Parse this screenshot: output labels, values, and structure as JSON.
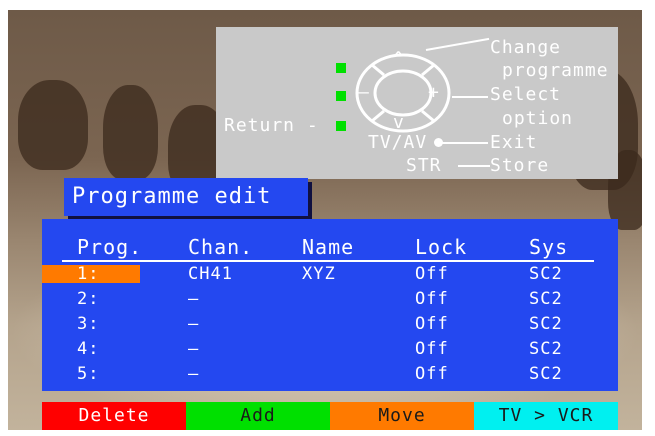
{
  "help": {
    "change_line1": "Change",
    "change_line2": "programme",
    "select_line1": "Select",
    "select_line2": "option",
    "return_label": "Return -",
    "tvav_label": "TV/AV",
    "exit_label": "Exit",
    "str_label": "STR",
    "store_label": "Store",
    "pad_up": "^",
    "pad_down": "v",
    "pad_left": "–",
    "pad_right": "+"
  },
  "title": "Programme edit",
  "table": {
    "headers": [
      "Prog.",
      "Chan.",
      "Name",
      "Lock",
      "Sys"
    ],
    "rows": [
      {
        "prog": "1:",
        "chan": "CH41",
        "name": "XYZ",
        "lock": "Off",
        "sys": "SC2"
      },
      {
        "prog": "2:",
        "chan": "–",
        "name": "",
        "lock": "Off",
        "sys": "SC2"
      },
      {
        "prog": "3:",
        "chan": "–",
        "name": "",
        "lock": "Off",
        "sys": "SC2"
      },
      {
        "prog": "4:",
        "chan": "–",
        "name": "",
        "lock": "Off",
        "sys": "SC2"
      },
      {
        "prog": "5:",
        "chan": "–",
        "name": "",
        "lock": "Off",
        "sys": "SC2"
      }
    ],
    "selected_row": 0
  },
  "buttons": {
    "delete": "Delete",
    "add": "Add",
    "move": "Move",
    "tv_vcr": "TV > VCR"
  },
  "colors": {
    "menu_blue": "#2448f0",
    "highlight_orange": "#ff7a00",
    "red": "#ff0000",
    "green": "#00e000",
    "cyan": "#00f0f0",
    "panel_grey": "#c9c9c9"
  }
}
